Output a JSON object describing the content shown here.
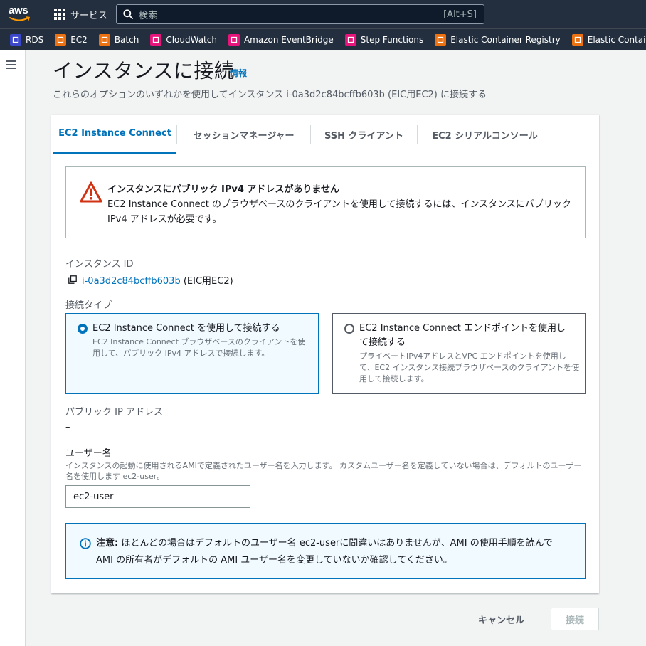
{
  "topbar": {
    "logo_text": "aws",
    "services_label": "サービス",
    "search_placeholder": "検索",
    "search_shortcut": "[Alt+S]"
  },
  "favorites": [
    {
      "label": "RDS",
      "icon": "rds-icon",
      "color": "#3b48cc"
    },
    {
      "label": "EC2",
      "icon": "ec2-icon",
      "color": "#ec7211"
    },
    {
      "label": "Batch",
      "icon": "batch-icon",
      "color": "#ec7211"
    },
    {
      "label": "CloudWatch",
      "icon": "cloudwatch-icon",
      "color": "#e7157b"
    },
    {
      "label": "Amazon EventBridge",
      "icon": "eventbridge-icon",
      "color": "#e7157b"
    },
    {
      "label": "Step Functions",
      "icon": "step-functions-icon",
      "color": "#e7157b"
    },
    {
      "label": "Elastic Container Registry",
      "icon": "ecr-icon",
      "color": "#ec7211"
    },
    {
      "label": "Elastic Container Service",
      "icon": "ecs-icon",
      "color": "#ec7211"
    }
  ],
  "header": {
    "title": "インスタンスに接続",
    "info_link": "情報",
    "subtitle": "これらのオプションのいずれかを使用してインスタンス i-0a3d2c84bcffb603b (EIC用EC2) に接続する"
  },
  "tabs": [
    {
      "label": "EC2 Instance Connect",
      "active": true
    },
    {
      "label": "セッションマネージャー",
      "active": false
    },
    {
      "label": "SSH クライアント",
      "active": false
    },
    {
      "label": "EC2 シリアルコンソール",
      "active": false
    }
  ],
  "warning": {
    "title": "インスタンスにパブリック IPv4 アドレスがありません",
    "body": "EC2 Instance Connect のブラウザベースのクライアントを使用して接続するには、インスタンスにパブリック IPv4 アドレスが必要です。"
  },
  "instance": {
    "label": "インスタンス ID",
    "id": "i-0a3d2c84bcffb603b",
    "name": " (EIC用EC2)"
  },
  "connection_type": {
    "label": "接続タイプ",
    "options": [
      {
        "title": "EC2 Instance Connect を使用して接続する",
        "desc": "EC2 Instance Connect ブラウザベースのクライアントを使用して、パブリック IPv4 アドレスで接続します。",
        "selected": true
      },
      {
        "title": "EC2 Instance Connect エンドポイントを使用して接続する",
        "desc": "プライベートIPv4アドレスとVPC エンドポイントを使用して、EC2 インスタンス接続ブラウザベースのクライアントを使用して接続します。",
        "selected": false
      }
    ]
  },
  "public_ip": {
    "label": "パブリック IP アドレス",
    "value": "–"
  },
  "username": {
    "label": "ユーザー名",
    "help": "インスタンスの起動に使用されるAMIで定義されたユーザー名を入力します。 カスタムユーザー名を定義していない場合は、デフォルトのユーザー名を使用します ec2-user。",
    "value": "ec2-user"
  },
  "note": {
    "prefix": "注意:",
    "text": " ほとんどの場合はデフォルトのユーザー名 ec2-userに間違いはありませんが、AMI の使用手順を読んで AMI の所有者がデフォルトの AMI ユーザー名を変更していないか確認してください。"
  },
  "actions": {
    "cancel": "キャンセル",
    "connect": "接続"
  },
  "colors": {
    "nav_bg": "#232f3e",
    "accent": "#0073bb",
    "warning": "#d13212",
    "aws_orange": "#ff9900"
  }
}
